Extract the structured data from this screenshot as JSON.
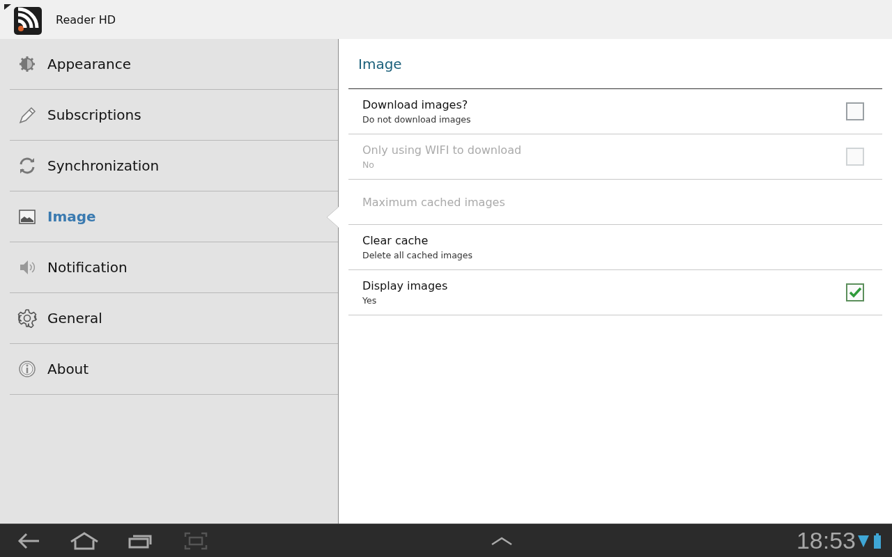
{
  "app_bar": {
    "title": "Reader HD"
  },
  "sidebar": {
    "items": [
      {
        "label": "Appearance",
        "kind": "appearance",
        "selected": false
      },
      {
        "label": "Subscriptions",
        "kind": "pencil",
        "selected": false
      },
      {
        "label": "Synchronization",
        "kind": "sync",
        "selected": false
      },
      {
        "label": "Image",
        "kind": "image",
        "selected": true
      },
      {
        "label": "Notification",
        "kind": "speaker",
        "selected": false
      },
      {
        "label": "General",
        "kind": "gear",
        "selected": false
      },
      {
        "label": "About",
        "kind": "info",
        "selected": false
      }
    ]
  },
  "panel": {
    "title": "Image",
    "settings": [
      {
        "kind": "checkbox",
        "title": "Download images?",
        "summary": "Do not download images",
        "checked": false,
        "disabled": false
      },
      {
        "kind": "checkbox",
        "title": "Only using WIFI to download",
        "summary": "No",
        "checked": false,
        "disabled": true
      },
      {
        "kind": "plain",
        "title": "Maximum cached images",
        "disabled": true
      },
      {
        "kind": "plain",
        "title": "Clear cache",
        "summary": "Delete all cached images",
        "disabled": false
      },
      {
        "kind": "checkbox",
        "title": "Display images",
        "summary": "Yes",
        "checked": true,
        "disabled": false
      }
    ]
  },
  "system_bar": {
    "time": "18:53"
  }
}
